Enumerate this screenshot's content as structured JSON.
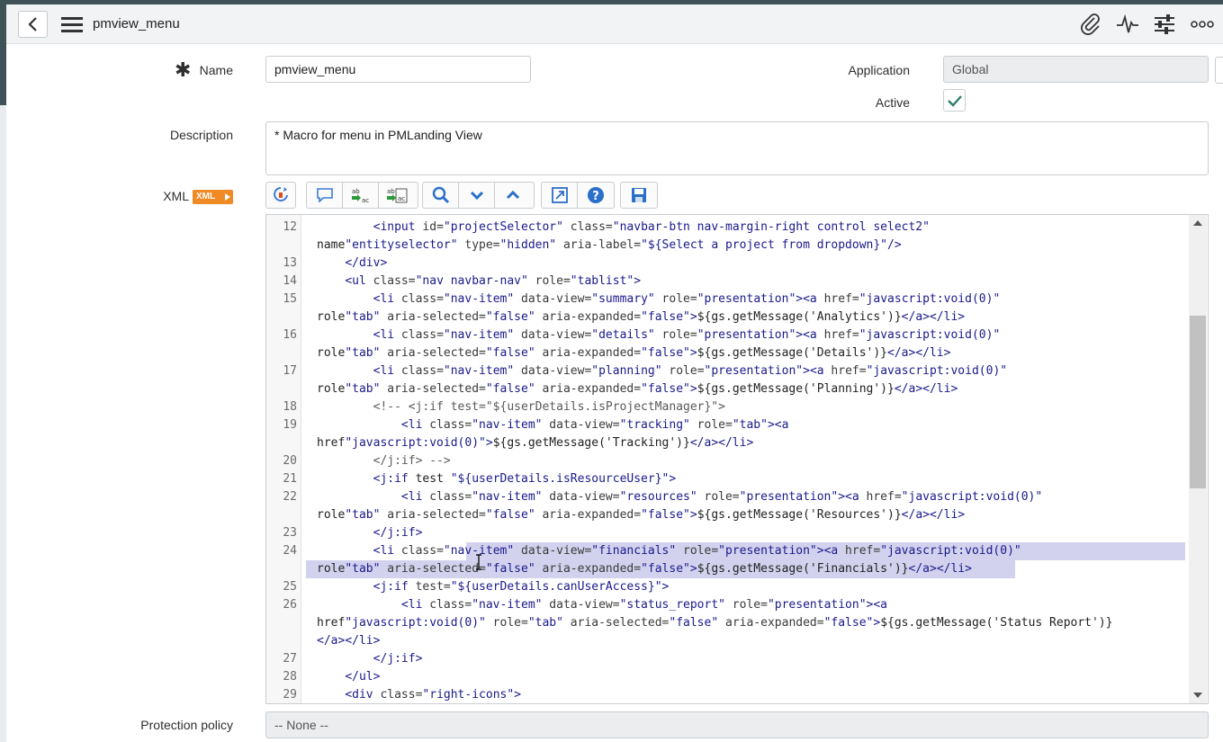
{
  "header": {
    "title": "pmview_menu",
    "icons": [
      "back-icon",
      "hamburger-icon",
      "attachment-icon",
      "activity-icon",
      "settings-sliders-icon",
      "more-icon"
    ]
  },
  "form": {
    "name_label": "Name",
    "name_value": "pmview_menu",
    "application_label": "Application",
    "application_value": "Global",
    "active_label": "Active",
    "active_checked": true,
    "description_label": "Description",
    "description_value": "* Macro for menu in PMLanding View",
    "xml_label": "XML",
    "xml_badge": "XML",
    "protection_label": "Protection policy",
    "protection_value": "-- None --"
  },
  "toolbar": {
    "buttons": [
      "format-icon",
      "comment-icon",
      "replace-icon",
      "replace-all-icon",
      "search-icon",
      "chevron-down-icon",
      "chevron-up-icon",
      "expand-icon",
      "help-icon",
      "save-icon"
    ]
  },
  "code": {
    "lines": [
      {
        "n": "12",
        "text": "        <input id=\"projectSelector\" class=\"navbar-btn nav-margin-right control select2\""
      },
      {
        "n": "",
        "text": "name=\"entityselector\" type=\"hidden\" aria-label=\"${Select a project from dropdown}\"/>"
      },
      {
        "n": "13",
        "text": "    </div>"
      },
      {
        "n": "14",
        "text": "    <ul class=\"nav navbar-nav\" role=\"tablist\">"
      },
      {
        "n": "15",
        "text": "        <li class=\"nav-item\" data-view=\"summary\" role=\"presentation\"><a href=\"javascript:void(0)\""
      },
      {
        "n": "",
        "text": "role=\"tab\" aria-selected=\"false\" aria-expanded=\"false\">${gs.getMessage('Analytics')}</a></li>"
      },
      {
        "n": "16",
        "text": "        <li class=\"nav-item\" data-view=\"details\" role=\"presentation\"><a href=\"javascript:void(0)\""
      },
      {
        "n": "",
        "text": "role=\"tab\" aria-selected=\"false\" aria-expanded=\"false\">${gs.getMessage('Details')}</a></li>"
      },
      {
        "n": "17",
        "text": "        <li class=\"nav-item\" data-view=\"planning\" role=\"presentation\"><a href=\"javascript:void(0)\""
      },
      {
        "n": "",
        "text": "role=\"tab\" aria-selected=\"false\" aria-expanded=\"false\">${gs.getMessage('Planning')}</a></li>"
      },
      {
        "n": "18",
        "text": "        <!-- <j:if test=\"${userDetails.isProjectManager}\">"
      },
      {
        "n": "19",
        "text": "            <li class=\"nav-item\" data-view=\"tracking\" role=\"tab\"><a"
      },
      {
        "n": "",
        "text": "href=\"javascript:void(0)\">${gs.getMessage('Tracking')}</a></li>"
      },
      {
        "n": "20",
        "text": "        </j:if> -->"
      },
      {
        "n": "21",
        "text": "        <j:if test =\"${userDetails.isResourceUser}\">"
      },
      {
        "n": "22",
        "text": "            <li class=\"nav-item\" data-view=\"resources\" role=\"presentation\"><a href=\"javascript:void(0)\""
      },
      {
        "n": "",
        "text": "role=\"tab\" aria-selected=\"false\" aria-expanded=\"false\">${gs.getMessage('Resources')}</a></li>"
      },
      {
        "n": "23",
        "text": "        </j:if>"
      },
      {
        "n": "24",
        "text": "        <li class=\"nav-item\" data-view=\"financials\" role=\"presentation\"><a href=\"javascript:void(0)\""
      },
      {
        "n": "",
        "text": "role=\"tab\" aria-selected=\"false\" aria-expanded=\"false\">${gs.getMessage('Financials')}</a></li>"
      },
      {
        "n": "25",
        "text": "        <j:if test=\"${userDetails.canUserAccess}\">"
      },
      {
        "n": "26",
        "text": "            <li class=\"nav-item\" data-view=\"status_report\" role=\"presentation\"><a"
      },
      {
        "n": "",
        "text": "href=\"javascript:void(0)\" role=\"tab\" aria-selected=\"false\" aria-expanded=\"false\">${gs.getMessage('Status Report')}"
      },
      {
        "n": "",
        "text": "</a></li>"
      },
      {
        "n": "27",
        "text": "        </j:if>"
      },
      {
        "n": "28",
        "text": "    </ul>"
      },
      {
        "n": "29",
        "text": "    <div class=\"right-icons\">"
      }
    ],
    "selected_lines": [
      19,
      20
    ]
  },
  "colors": {
    "accent": "#f08a24",
    "selection": "#d2d2ee",
    "header_bg": "#f1f3f4",
    "check": "#2e7d6b"
  }
}
